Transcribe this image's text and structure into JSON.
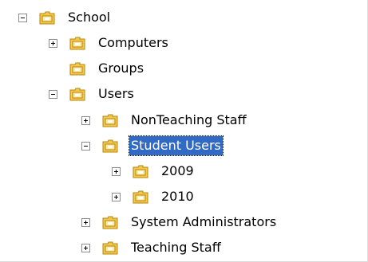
{
  "tree": {
    "nodes": [
      {
        "label": "School",
        "expander": "minus",
        "selected": false
      },
      {
        "label": "Computers",
        "expander": "plus",
        "selected": false
      },
      {
        "label": "Groups",
        "expander": "none",
        "selected": false
      },
      {
        "label": "Users",
        "expander": "minus",
        "selected": false
      },
      {
        "label": "NonTeaching Staff",
        "expander": "plus",
        "selected": false
      },
      {
        "label": "Student Users",
        "expander": "minus",
        "selected": true
      },
      {
        "label": "2009",
        "expander": "plus",
        "selected": false
      },
      {
        "label": "2010",
        "expander": "plus",
        "selected": false
      },
      {
        "label": "System Administrators",
        "expander": "plus",
        "selected": false
      },
      {
        "label": "Teaching Staff",
        "expander": "plus",
        "selected": false
      }
    ]
  },
  "colors": {
    "selection": "#316ac5",
    "folder_body": "#f2c94c",
    "folder_border": "#b8860b",
    "folder_inner": "#fbe9a6"
  }
}
